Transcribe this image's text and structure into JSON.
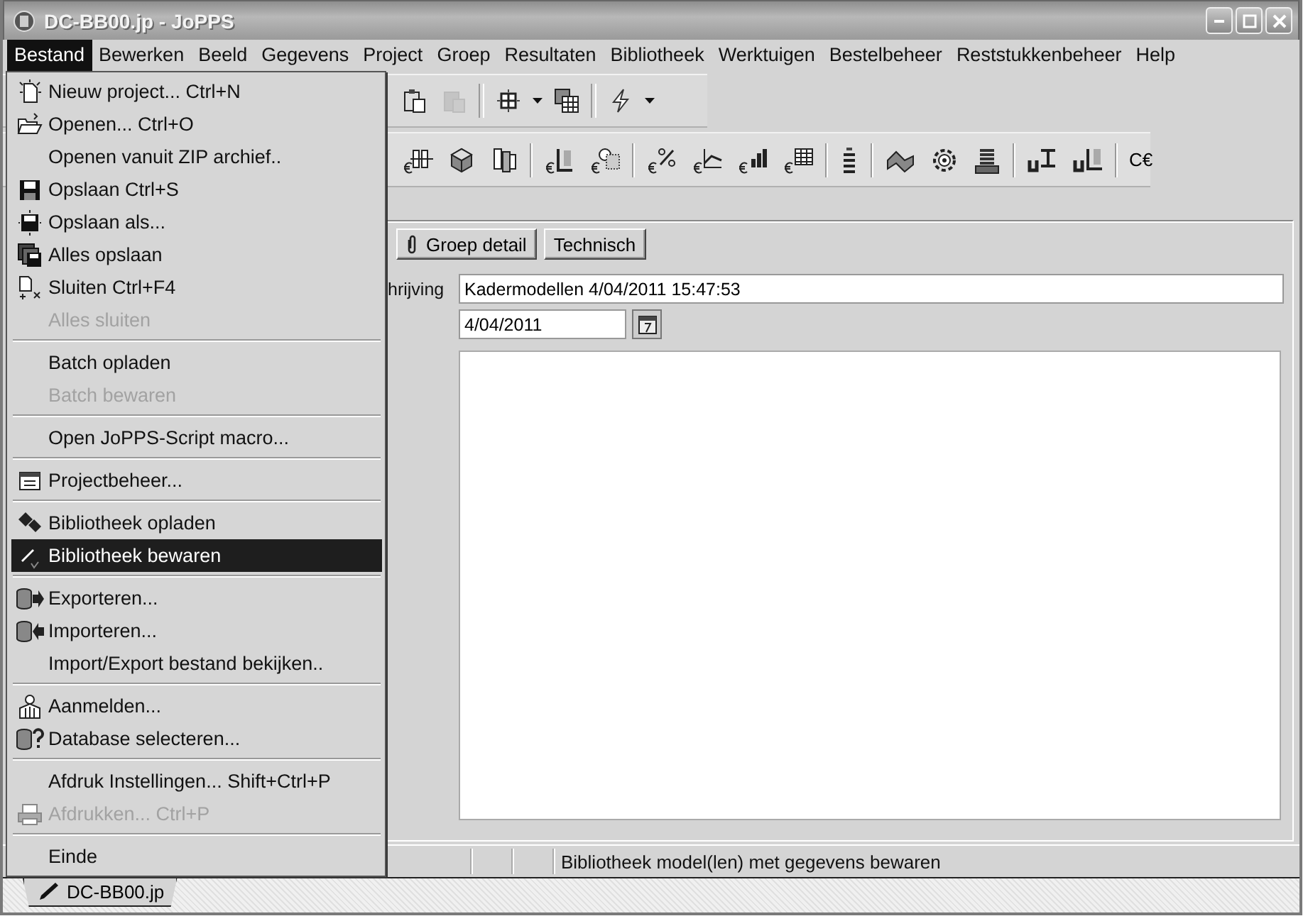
{
  "window": {
    "title": "DC-BB00.jp - JoPPS"
  },
  "menubar": [
    {
      "label": "Bestand",
      "selected": true
    },
    {
      "label": "Bewerken",
      "selected": false
    },
    {
      "label": "Beeld",
      "selected": false
    },
    {
      "label": "Gegevens",
      "selected": false
    },
    {
      "label": "Project",
      "selected": false
    },
    {
      "label": "Groep",
      "selected": false
    },
    {
      "label": "Resultaten",
      "selected": false
    },
    {
      "label": "Bibliotheek",
      "selected": false
    },
    {
      "label": "Werktuigen",
      "selected": false
    },
    {
      "label": "Bestelbeheer",
      "selected": false
    },
    {
      "label": "Reststukkenbeheer",
      "selected": false
    },
    {
      "label": "Help",
      "selected": false
    }
  ],
  "toolbars": [
    [
      {
        "kind": "button",
        "disabled": false
      },
      {
        "kind": "button",
        "disabled": true
      },
      {
        "kind": "separator"
      },
      {
        "kind": "button",
        "disabled": false
      },
      {
        "kind": "dropdown"
      },
      {
        "kind": "button",
        "disabled": false
      },
      {
        "kind": "separator"
      },
      {
        "kind": "button",
        "disabled": false
      },
      {
        "kind": "dropdown"
      }
    ],
    [
      {
        "kind": "button",
        "disabled": false
      },
      {
        "kind": "button",
        "disabled": false
      },
      {
        "kind": "button",
        "disabled": false
      },
      {
        "kind": "separator"
      },
      {
        "kind": "button",
        "disabled": false
      },
      {
        "kind": "button",
        "disabled": false
      },
      {
        "kind": "separator"
      },
      {
        "kind": "button",
        "disabled": false
      },
      {
        "kind": "button",
        "disabled": false
      },
      {
        "kind": "button",
        "disabled": false
      },
      {
        "kind": "button",
        "disabled": false
      },
      {
        "kind": "separator"
      },
      {
        "kind": "button",
        "disabled": false
      },
      {
        "kind": "separator"
      },
      {
        "kind": "button",
        "disabled": false
      },
      {
        "kind": "button",
        "disabled": false
      },
      {
        "kind": "button",
        "disabled": false
      },
      {
        "kind": "separator"
      },
      {
        "kind": "button",
        "disabled": false
      },
      {
        "kind": "button",
        "disabled": false
      },
      {
        "kind": "separator"
      },
      {
        "kind": "text",
        "label": "C€",
        "disabled": false
      }
    ]
  ],
  "tabs": [
    {
      "label": "Groep detail",
      "selected": false
    },
    {
      "label": "Technisch",
      "selected": false
    }
  ],
  "form": {
    "description_label": "hrijving",
    "description": "Kadermodellen 4/04/2011 15:47:53",
    "date": "4/04/2011"
  },
  "file_menu": [
    {
      "kind": "item",
      "label": "Nieuw project... Ctrl+N",
      "disabled": false,
      "selected": false
    },
    {
      "kind": "item",
      "label": "Openen... Ctrl+O",
      "disabled": false,
      "selected": false
    },
    {
      "kind": "item",
      "label": "Openen vanuit ZIP archief..",
      "disabled": false,
      "selected": false
    },
    {
      "kind": "item",
      "label": "Opslaan Ctrl+S",
      "disabled": false,
      "selected": false
    },
    {
      "kind": "item",
      "label": "Opslaan als...",
      "disabled": false,
      "selected": false
    },
    {
      "kind": "item",
      "label": "Alles opslaan",
      "disabled": false,
      "selected": false
    },
    {
      "kind": "item",
      "label": "Sluiten Ctrl+F4",
      "disabled": false,
      "selected": false
    },
    {
      "kind": "item",
      "label": "Alles sluiten",
      "disabled": true,
      "selected": false
    },
    {
      "kind": "separator"
    },
    {
      "kind": "item",
      "label": "Batch opladen",
      "disabled": false,
      "selected": false
    },
    {
      "kind": "item",
      "label": "Batch bewaren",
      "disabled": true,
      "selected": false
    },
    {
      "kind": "separator"
    },
    {
      "kind": "item",
      "label": "Open JoPPS-Script macro...",
      "disabled": false,
      "selected": false
    },
    {
      "kind": "separator"
    },
    {
      "kind": "item",
      "label": "Projectbeheer...",
      "disabled": false,
      "selected": false
    },
    {
      "kind": "separator"
    },
    {
      "kind": "item",
      "label": "Bibliotheek opladen",
      "disabled": false,
      "selected": false
    },
    {
      "kind": "item",
      "label": "Bibliotheek bewaren",
      "disabled": false,
      "selected": true
    },
    {
      "kind": "separator"
    },
    {
      "kind": "item",
      "label": "Exporteren...",
      "disabled": false,
      "selected": false
    },
    {
      "kind": "item",
      "label": "Importeren...",
      "disabled": false,
      "selected": false
    },
    {
      "kind": "item",
      "label": "Import/Export bestand bekijken..",
      "disabled": false,
      "selected": false
    },
    {
      "kind": "separator"
    },
    {
      "kind": "item",
      "label": "Aanmelden...",
      "disabled": false,
      "selected": false
    },
    {
      "kind": "item",
      "label": "Database selecteren...",
      "disabled": false,
      "selected": false
    },
    {
      "kind": "separator"
    },
    {
      "kind": "item",
      "label": "Afdruk Instellingen... Shift+Ctrl+P",
      "disabled": false,
      "selected": false
    },
    {
      "kind": "item",
      "label": "Afdrukken... Ctrl+P",
      "disabled": true,
      "selected": false
    },
    {
      "kind": "separator"
    },
    {
      "kind": "item",
      "label": "Einde",
      "disabled": false,
      "selected": false
    }
  ],
  "status_bar": {
    "message": "Bibliotheek model(len) met gegevens bewaren"
  },
  "document_tabs": [
    {
      "label": "DC-BB00.jp",
      "selected": true
    }
  ]
}
